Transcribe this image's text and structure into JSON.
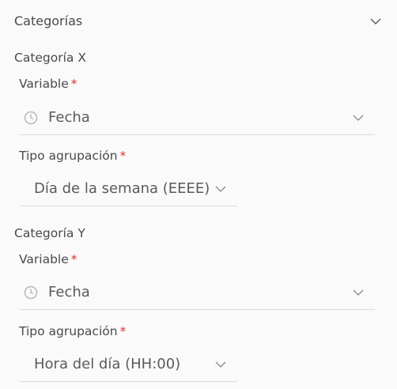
{
  "section": {
    "title": "Categorías"
  },
  "category_x": {
    "title": "Categoría X",
    "variable": {
      "label": "Variable",
      "required": "*",
      "value": "Fecha",
      "icon": "clock-icon"
    },
    "grouping": {
      "label": "Tipo agrupación",
      "required": "*",
      "value": "Día de la semana (EEEE)"
    }
  },
  "category_y": {
    "title": "Categoría Y",
    "variable": {
      "label": "Variable",
      "required": "*",
      "value": "Fecha",
      "icon": "clock-icon"
    },
    "grouping": {
      "label": "Tipo agrupación",
      "required": "*",
      "value": "Hora del día (HH:00)"
    }
  },
  "colors": {
    "required": "#e2342b",
    "divider": "#dcdcdc",
    "text": "#4a4a4a"
  }
}
